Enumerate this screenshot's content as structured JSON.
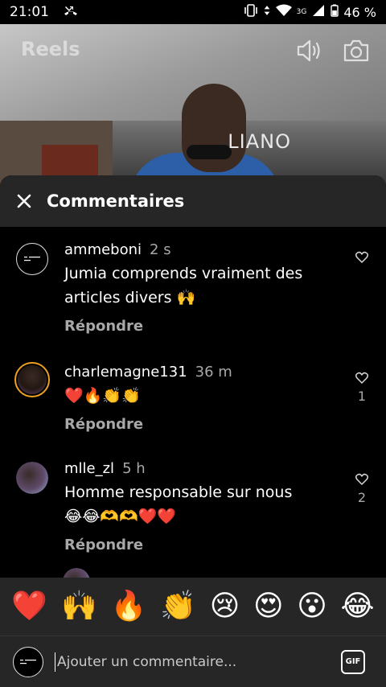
{
  "status_bar": {
    "time": "21:01",
    "battery": "46 %",
    "network": "3G"
  },
  "reels": {
    "title": "Reels",
    "sign_text": "LIANO"
  },
  "sheet": {
    "title": "Commentaires"
  },
  "comments": [
    {
      "username": "ammeboni",
      "time": "2 s",
      "text": "Jumia comprends vraiment des articles divers 🙌",
      "reply_label": "Répondre",
      "likes": ""
    },
    {
      "username": "charlemagne131",
      "time": "36 m",
      "text": "❤️🔥👏👏",
      "reply_label": "Répondre",
      "likes": "1"
    },
    {
      "username": "mlle_zl",
      "time": "5 h",
      "text": "Homme responsable sur nous 😂😂🫶🫶❤️❤️",
      "reply_label": "Répondre",
      "likes": "2"
    }
  ],
  "emoji_bar": [
    "❤️",
    "🙌",
    "🔥",
    "👏",
    "😢",
    "😍",
    "😮",
    "😂"
  ],
  "input": {
    "placeholder": "Ajouter un commentaire...",
    "gif_label": "GIF"
  },
  "colors": {
    "sheet_bg": "#262626",
    "muted_text": "#a8a8a8",
    "story_ring": "#f0a020"
  }
}
